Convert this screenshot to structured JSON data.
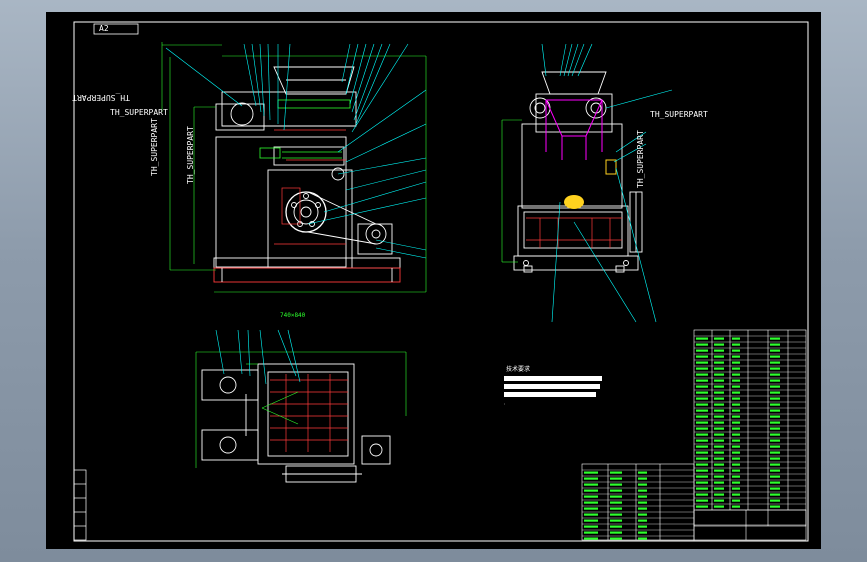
{
  "drawing": {
    "sheet_code": "A2",
    "superpart_labels": [
      "TH_SUPERPART",
      "TH_SUPERPART",
      "TH_SUPERPART",
      "TH_SUPERPART",
      "TH_SUPERPART",
      "TH_SUPERPART"
    ],
    "plan_view_dim": "740×840",
    "notes_title": "技术要求",
    "notes_lines": [
      "1.装配前清洗所有零件。",
      "2.各轴承加注润滑脂。",
      "3.试运转无异常噪声。",
      "4.表面涂漆。"
    ]
  },
  "colors": {
    "background": "#000000",
    "geometry": "#ffffff",
    "dimension": "#2dff2d",
    "leader": "#00ffff",
    "hidden": "#ff3b3b",
    "highlight": "#ff00ff",
    "frame_bg": "#8d9bab"
  }
}
